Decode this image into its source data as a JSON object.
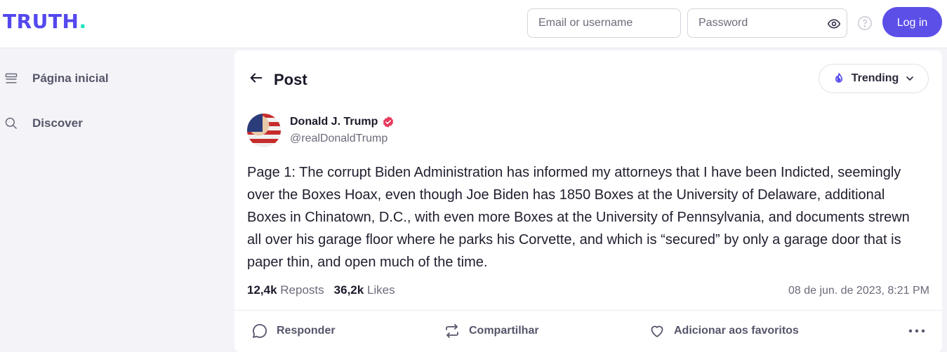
{
  "header": {
    "logo_main": "TRUTH",
    "logo_dot": ".",
    "email_placeholder": "Email or username",
    "password_placeholder": "Password",
    "login_label": "Log in"
  },
  "sidebar": {
    "items": [
      {
        "label": "Página inicial",
        "icon": "home-icon"
      },
      {
        "label": "Discover",
        "icon": "search-icon"
      }
    ]
  },
  "post": {
    "page_title": "Post",
    "trending_label": "Trending",
    "author_name": "Donald J. Trump",
    "author_handle": "@realDonaldTrump",
    "text": "Page 1: The corrupt Biden Administration has informed my attorneys that I have been Indicted, seemingly over the Boxes Hoax, even though Joe Biden has 1850 Boxes at the University of Delaware, additional Boxes in Chinatown, D.C., with even more Boxes at the University of Pennsylvania, and documents strewn all over his garage floor where he parks his Corvette, and which is “secured” by only a garage door that is paper thin, and open much of the time.",
    "reposts_count": "12,4k",
    "reposts_label": "Reposts",
    "likes_count": "36,2k",
    "likes_label": "Likes",
    "timestamp": "08 de jun. de 2023, 8:21 PM"
  },
  "actions": {
    "reply_label": "Responder",
    "share_label": "Compartilhar",
    "favorite_label": "Adicionar aos favoritos"
  },
  "colors": {
    "brand": "#5448ee",
    "brand_accent": "#17e6bd",
    "login_button": "#5c4fe8",
    "verified_badge": "#e8395c"
  }
}
